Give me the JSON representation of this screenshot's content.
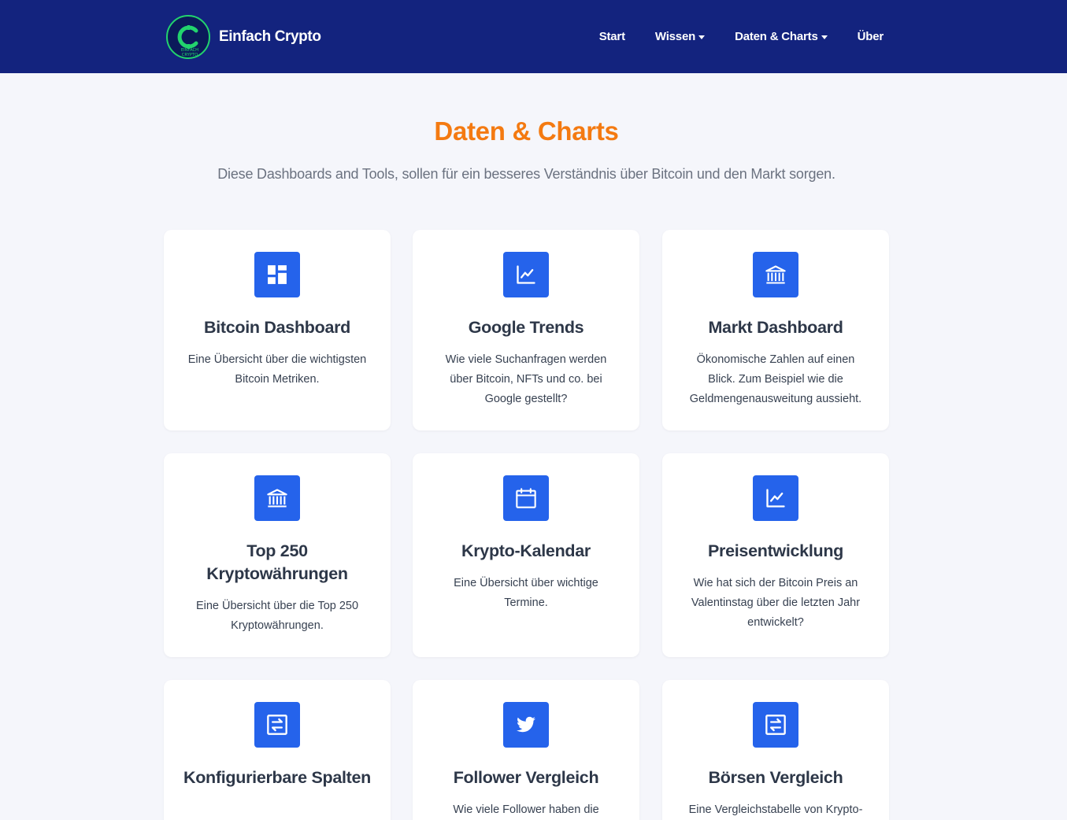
{
  "header": {
    "logo_text_top": "EINFACH",
    "logo_text_bottom": "CRYPTO",
    "brand": "Einfach Crypto",
    "nav": [
      {
        "label": "Start",
        "dropdown": false
      },
      {
        "label": "Wissen",
        "dropdown": true
      },
      {
        "label": "Daten & Charts",
        "dropdown": true
      },
      {
        "label": "Über",
        "dropdown": false
      }
    ]
  },
  "main": {
    "title": "Daten & Charts",
    "subtitle": "Diese Dashboards and Tools, sollen für ein besseres Verständnis über Bitcoin und den Markt sorgen.",
    "cards": [
      {
        "icon": "dashboard-icon",
        "title": "Bitcoin Dashboard",
        "text": "Eine Übersicht über die wichtigsten Bitcoin Metriken."
      },
      {
        "icon": "trend-chart-icon",
        "title": "Google Trends",
        "text": "Wie viele Suchanfragen werden über Bitcoin, NFTs und co. bei Google gestellt?"
      },
      {
        "icon": "bank-icon",
        "title": "Markt Dashboard",
        "text": "Ökonomische Zahlen auf einen Blick. Zum Beispiel wie die Geldmengenausweitung aussieht."
      },
      {
        "icon": "bank-icon",
        "title": "Top 250 Kryptowährungen",
        "text": "Eine Übersicht über die Top 250 Kryptowährungen."
      },
      {
        "icon": "calendar-icon",
        "title": "Krypto-Kalendar",
        "text": "Eine Übersicht über wichtige Termine."
      },
      {
        "icon": "trend-chart-icon",
        "title": "Preisentwicklung",
        "text": "Wie hat sich der Bitcoin Preis an Valentinstag über die letzten Jahr entwickelt?"
      },
      {
        "icon": "exchange-icon",
        "title": "Konfigurierbare Spalten",
        "text": ""
      },
      {
        "icon": "twitter-icon",
        "title": "Follower Vergleich",
        "text": "Wie viele Follower haben die"
      },
      {
        "icon": "exchange-icon",
        "title": "Börsen Vergleich",
        "text": "Eine Vergleichstabelle von Krypto-"
      }
    ]
  }
}
